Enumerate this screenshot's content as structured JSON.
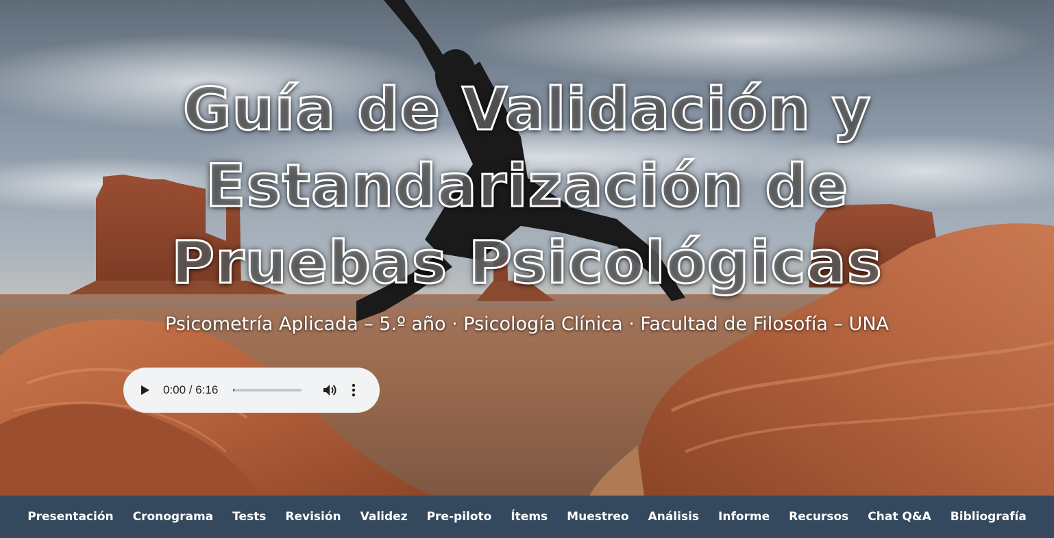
{
  "hero": {
    "title_lines": [
      "Guía de Validación y",
      "Estandarización de",
      "Pruebas Psicológicas"
    ],
    "subtitle": "Psicometría Aplicada – 5.º año · Psicología Clínica · Facultad de Filosofía – UNA",
    "background_icon": "desert-landscape-jumping-person-photo"
  },
  "audio_player": {
    "time": "0:00 / 6:16",
    "progress": 0.0,
    "play_icon": "play-icon",
    "volume_icon": "volume-icon",
    "more_icon": "more-vert-icon"
  },
  "nav": {
    "items": [
      "Presentación",
      "Cronograma",
      "Tests",
      "Revisión",
      "Validez",
      "Pre-piloto",
      "Ítems",
      "Muestreo",
      "Análisis",
      "Informe",
      "Recursos",
      "Chat Q&A",
      "Bibliografía"
    ]
  },
  "colors": {
    "nav_background": "#34495e",
    "player_background": "#f1f3f4",
    "text": "#ffffff"
  }
}
